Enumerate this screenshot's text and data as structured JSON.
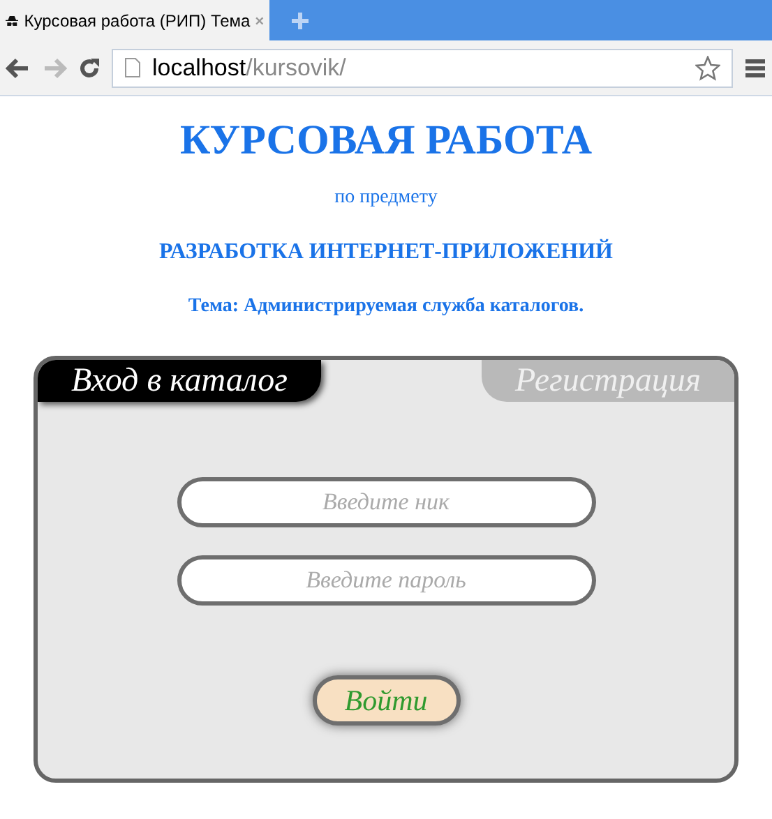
{
  "browser": {
    "tab_title": "Курсовая работа (РИП) Тема",
    "address_host": "localhost",
    "address_path": "/kursovik/"
  },
  "heading": {
    "title": "КУРСОВАЯ РАБОТА",
    "subject_label": "по предмету",
    "subject": "РАЗРАБОТКА ИНТЕРНЕТ-ПРИЛОЖЕНИЙ",
    "topic": "Тема: Администрируемая служба каталогов."
  },
  "tabs": [
    {
      "label": "Вход в каталог",
      "selected": true
    },
    {
      "label": "Регистрация",
      "selected": false
    }
  ],
  "fields": [
    {
      "placeholder": "Введите ник"
    },
    {
      "placeholder": "Введите пароль"
    }
  ],
  "submit": "Войти"
}
